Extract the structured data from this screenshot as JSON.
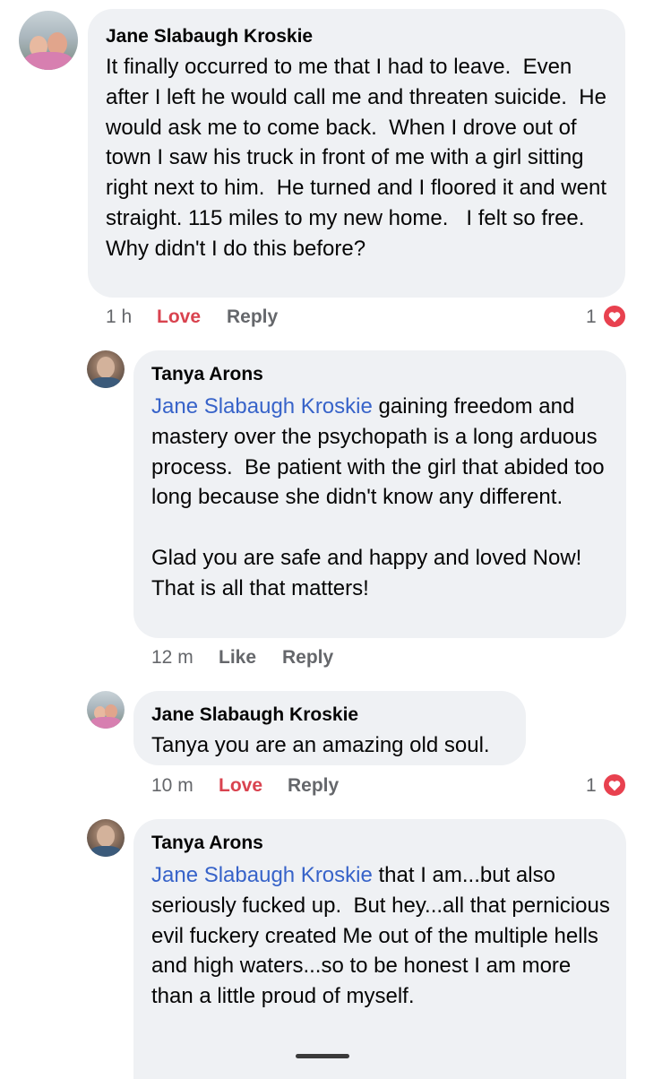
{
  "comments": [
    {
      "author": "Jane Slabaugh Kroskie",
      "text": "It finally occurred to me that I had to leave.  Even after I left he would call me and threaten suicide.  He would ask me to come back.  When I drove out of town I saw his truck in front of me with a girl sitting right next to him.  He turned and I floored it and went straight. 115 miles to my new home.   I felt so free.  Why didn't I do this before?",
      "time": "1 h",
      "reaction_action": "Love",
      "reply_label": "Reply",
      "reaction_count": "1"
    },
    {
      "author": "Tanya Arons",
      "mention": "Jane Slabaugh Kroskie",
      "text": " gaining freedom and mastery over the psychopath is a long arduous process.  Be patient with the girl that abided too long because she didn't know any different.\n\nGlad you are safe and happy and loved Now!  That is all that matters!",
      "time": "12 m",
      "reaction_action": "Like",
      "reply_label": "Reply"
    },
    {
      "author": "Jane Slabaugh Kroskie",
      "text": "Tanya you are an amazing old soul.",
      "time": "10 m",
      "reaction_action": "Love",
      "reply_label": "Reply",
      "reaction_count": "1"
    },
    {
      "author": "Tanya Arons",
      "mention": "Jane Slabaugh Kroskie",
      "text": " that I am...but also seriously fucked up.  But hey...all that pernicious evil fuckery created Me out of the multiple hells and high waters...so to be honest I am more than a little proud of myself."
    }
  ],
  "colors": {
    "bubble": "#eff1f4",
    "mention": "#3763c9",
    "love": "#d9434f",
    "meta": "#65676b"
  },
  "icons": {
    "reaction": "heart-icon"
  }
}
